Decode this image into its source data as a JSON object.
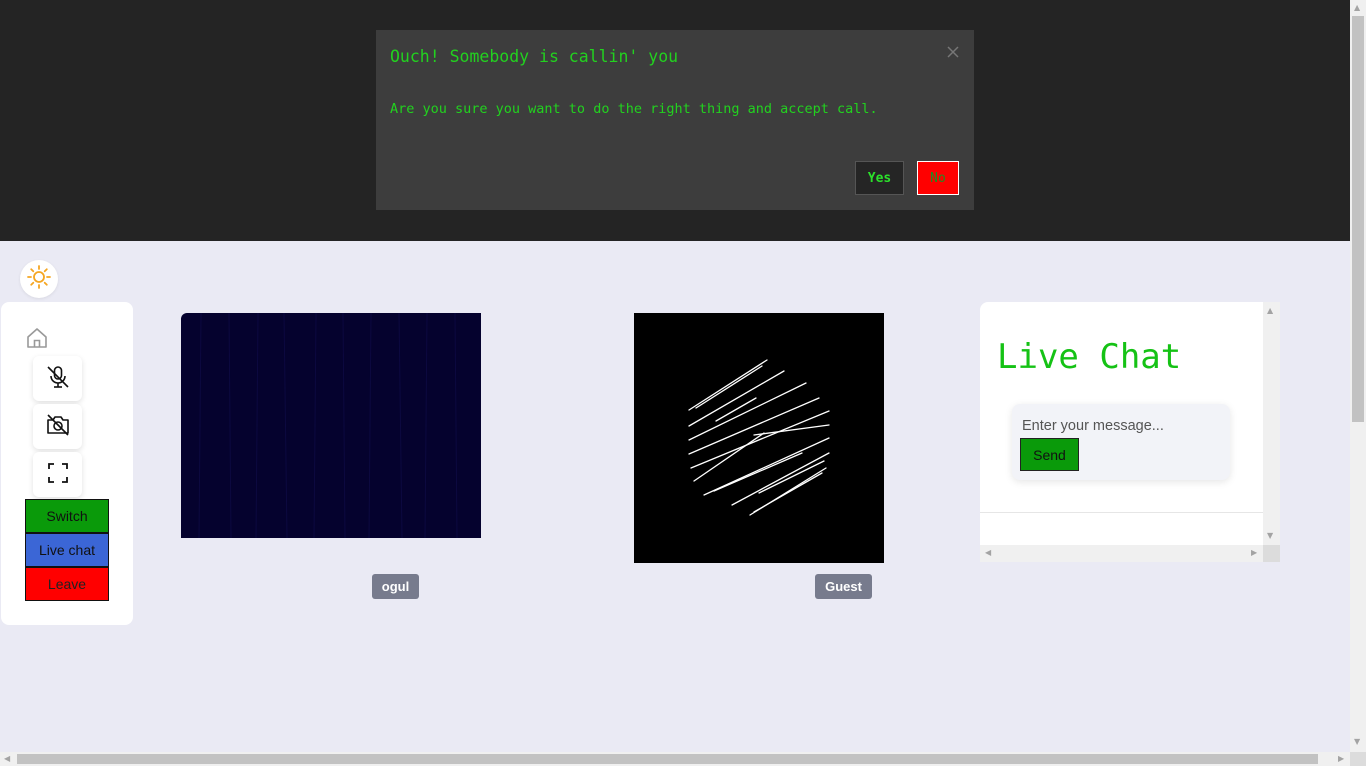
{
  "modal": {
    "title": "Ouch! Somebody is callin' you",
    "message": "Are you sure you want to do the right thing and accept call.",
    "yes_label": "Yes",
    "no_label": "No",
    "close_icon": "close-icon"
  },
  "theme_toggle": {
    "icon": "sun-icon"
  },
  "sidebar": {
    "home_icon": "home-icon",
    "mic_icon": "mic-off-icon",
    "camera_icon": "camera-off-icon",
    "fullscreen_icon": "fullscreen-icon",
    "switch_label": "Switch",
    "live_chat_label": "Live chat",
    "leave_label": "Leave"
  },
  "videos": [
    {
      "name": "ogul"
    },
    {
      "name": "Guest"
    }
  ],
  "chat": {
    "title": "Live Chat",
    "input_placeholder": "Enter your message...",
    "send_label": "Send"
  },
  "colors": {
    "top_band": "#242424",
    "modal_bg": "#3d3d3d",
    "modal_text": "#22d11f",
    "switch": "#0a9a0a",
    "live_chat": "#3b66d6",
    "leave": "#ff0000",
    "chat_title": "#15c215",
    "page_bg": "#eaeaf4"
  }
}
